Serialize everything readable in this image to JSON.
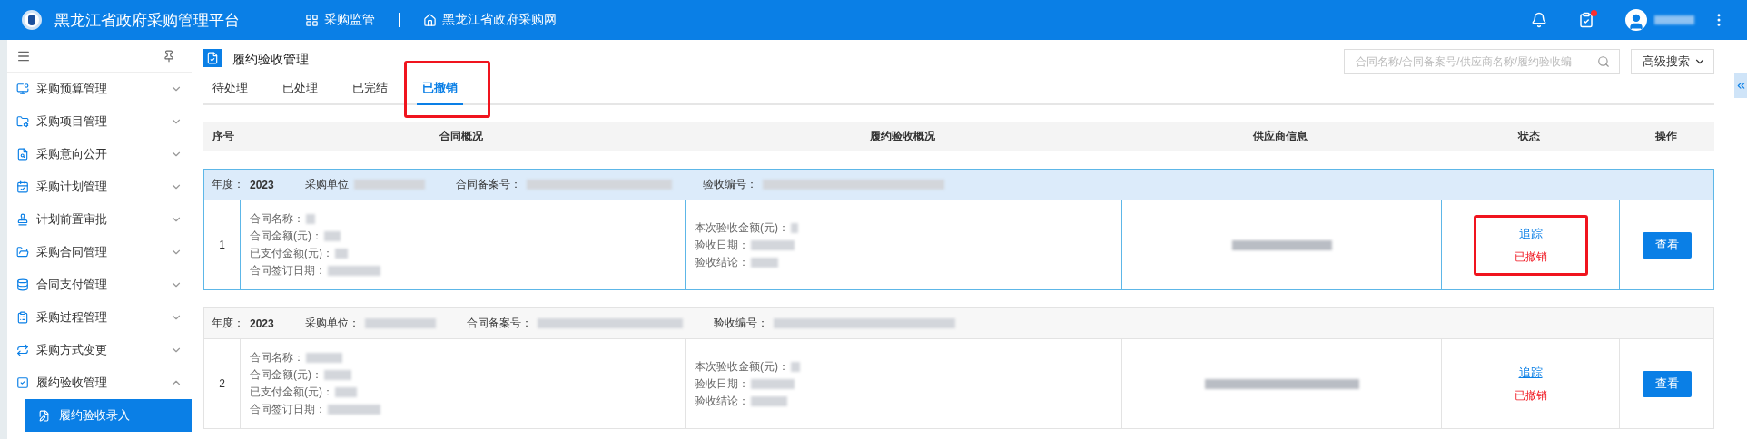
{
  "header": {
    "title": "黑龙江省政府采购管理平台",
    "nav": [
      {
        "label": "采购监管"
      },
      {
        "label": "黑龙江省政府采购网"
      }
    ],
    "task_badge": true
  },
  "sidebar": {
    "items": [
      {
        "label": "采购预算管理",
        "expanded": false
      },
      {
        "label": "采购项目管理",
        "expanded": false
      },
      {
        "label": "采购意向公开",
        "expanded": false
      },
      {
        "label": "采购计划管理",
        "expanded": false
      },
      {
        "label": "计划前置审批",
        "expanded": false
      },
      {
        "label": "采购合同管理",
        "expanded": false
      },
      {
        "label": "合同支付管理",
        "expanded": false
      },
      {
        "label": "采购过程管理",
        "expanded": false
      },
      {
        "label": "采购方式变更",
        "expanded": false
      },
      {
        "label": "履约验收管理",
        "expanded": true,
        "children": [
          {
            "label": "履约验收录入",
            "selected": true
          }
        ]
      }
    ]
  },
  "page": {
    "title": "履约验收管理",
    "tabs": [
      {
        "label": "待处理",
        "selected": false,
        "annotated": false
      },
      {
        "label": "已处理",
        "selected": false,
        "annotated": false
      },
      {
        "label": "已完结",
        "selected": false,
        "annotated": false
      },
      {
        "label": "已撤销",
        "selected": true,
        "annotated": true
      }
    ],
    "search": {
      "placeholder": "合同名称/合同备案号/供应商名称/履约验收编"
    },
    "advanced_search": "高级搜索"
  },
  "table": {
    "columns": [
      "序号",
      "合同概况",
      "履约验收概况",
      "供应商信息",
      "状态",
      "操作"
    ],
    "rows": [
      {
        "index": "1",
        "highlighted": true,
        "year_label": "年度：",
        "year": "2023",
        "unit_label": "采购单位",
        "record_label": "合同备案号：",
        "acceptance_no_label": "验收编号：",
        "contract_fields": [
          "合同名称：",
          "合同金额(元)：",
          "已支付金额(元)：",
          "合同签订日期："
        ],
        "acceptance_fields": [
          "本次验收金额(元)：",
          "验收日期：",
          "验收结论："
        ],
        "track_link": "追踪",
        "status": "已撤销",
        "status_annotated": true,
        "view_button": "查看"
      },
      {
        "index": "2",
        "highlighted": false,
        "year_label": "年度：",
        "year": "2023",
        "unit_label": "采购单位：",
        "record_label": "合同备案号：",
        "acceptance_no_label": "验收编号：",
        "contract_fields": [
          "合同名称：",
          "合同金额(元)：",
          "已支付金额(元)：",
          "合同签订日期："
        ],
        "acceptance_fields": [
          "本次验收金额(元)：",
          "验收日期：",
          "验收结论："
        ],
        "track_link": "追踪",
        "status": "已撤销",
        "status_annotated": false,
        "view_button": "查看"
      }
    ]
  }
}
